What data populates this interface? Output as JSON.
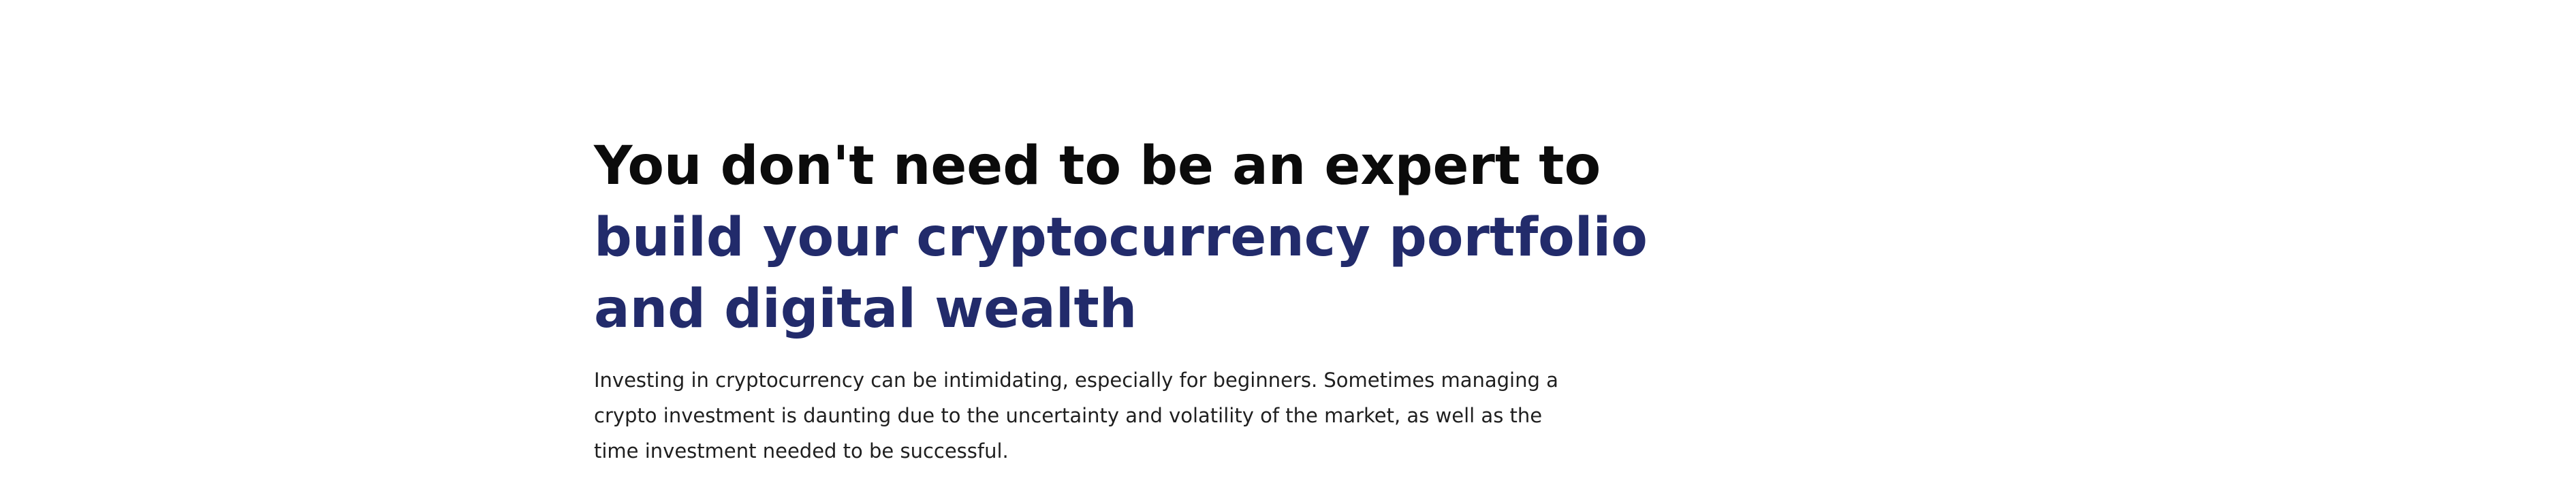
{
  "hero": {
    "heading_plain": "You don't need to be an expert to",
    "heading_accent": "build your cryptocurrency portfolio and digital wealth",
    "body": "Investing in cryptocurrency can be intimidating, especially for beginners. Sometimes managing a crypto investment is daunting due to the uncertainty and volatility of the market, as well as the time investment needed to be successful."
  },
  "colors": {
    "heading_text": "#0b0b0b",
    "accent": "#222b6b",
    "body_text": "#1f1f1f",
    "background": "#ffffff"
  }
}
